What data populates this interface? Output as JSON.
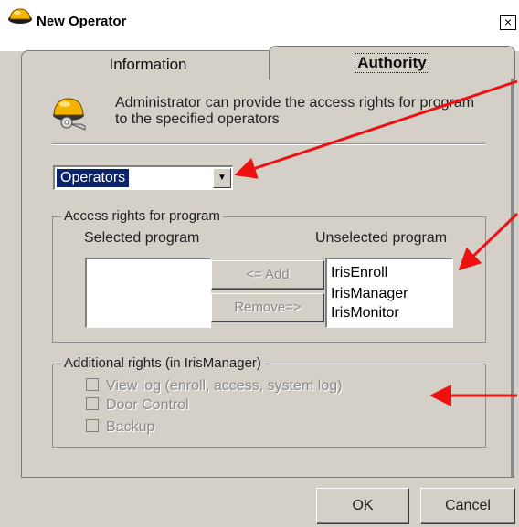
{
  "window": {
    "title": "New Operator",
    "close_label": "×"
  },
  "tabs": [
    {
      "label": "Information",
      "selected": false
    },
    {
      "label": "Authority",
      "selected": true
    }
  ],
  "description": "Administrator can provide the access rights for program to the specified operators",
  "operator_select": {
    "value": "Operators",
    "arrow": "▼"
  },
  "access_group": {
    "legend": "Access rights for program",
    "selected_label": "Selected program",
    "unselected_label": "Unselected program",
    "selected_items": [],
    "unselected_items": [
      "IrisEnroll",
      "IrisManager",
      "IrisMonitor"
    ],
    "add_button": "<= Add",
    "remove_button": "Remove=>"
  },
  "additional_group": {
    "legend": "Additional rights (in IrisManager)",
    "checkboxes": [
      {
        "label": "View log (enroll, access, system log)",
        "checked": false,
        "enabled": false
      },
      {
        "label": "Door Control",
        "checked": false,
        "enabled": false
      },
      {
        "label": "Backup",
        "checked": false,
        "enabled": false
      }
    ]
  },
  "footer": {
    "ok_label": "OK",
    "cancel_label": "Cancel"
  },
  "colors": {
    "dialog_bg": "#d4d0c8",
    "selection_bg": "#0a246a",
    "annotation_arrow": "#ee1111"
  },
  "icons": {
    "title": "helmet-icon",
    "description": "helmet-key-icon",
    "dropdown": "chevron-down-icon"
  }
}
